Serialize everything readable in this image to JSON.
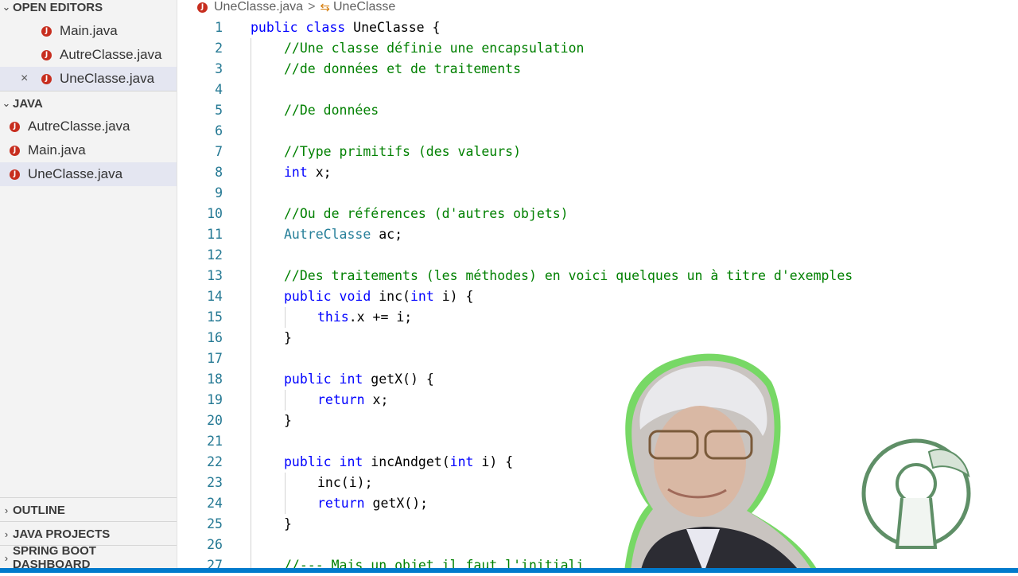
{
  "sidebar": {
    "open_editors": {
      "title": "OPEN EDITORS",
      "items": [
        {
          "label": "Main.java"
        },
        {
          "label": "AutreClasse.java"
        },
        {
          "label": "UneClasse.java",
          "close": "×"
        }
      ]
    },
    "java": {
      "title": "JAVA",
      "items": [
        {
          "label": "AutreClasse.java"
        },
        {
          "label": "Main.java"
        },
        {
          "label": "UneClasse.java"
        }
      ]
    },
    "panels": [
      {
        "label": "OUTLINE"
      },
      {
        "label": "JAVA PROJECTS"
      },
      {
        "label": "SPRING BOOT DASHBOARD"
      }
    ]
  },
  "breadcrumb": {
    "file": "UneClasse.java",
    "separator": ">",
    "symbol": "UneClasse"
  },
  "code_lines": [
    {
      "n": "1",
      "t": "public class UneClasse {"
    },
    {
      "n": "2",
      "t": "//Une classe définie une encapsulation"
    },
    {
      "n": "3",
      "t": "//de données et de traitements"
    },
    {
      "n": "4",
      "t": ""
    },
    {
      "n": "5",
      "t": "//De données"
    },
    {
      "n": "6",
      "t": ""
    },
    {
      "n": "7",
      "t": "//Type primitifs (des valeurs)"
    },
    {
      "n": "8",
      "t": "int x;"
    },
    {
      "n": "9",
      "t": ""
    },
    {
      "n": "10",
      "t": "//Ou de références (d'autres objets)"
    },
    {
      "n": "11",
      "t": "AutreClasse ac;"
    },
    {
      "n": "12",
      "t": ""
    },
    {
      "n": "13",
      "t": "//Des traitements (les méthodes) en voici quelques un à titre d'exemples"
    },
    {
      "n": "14",
      "t": "public void inc(int i) {"
    },
    {
      "n": "15",
      "t": "this.x += i;"
    },
    {
      "n": "16",
      "t": "}"
    },
    {
      "n": "17",
      "t": ""
    },
    {
      "n": "18",
      "t": "public int getX() {"
    },
    {
      "n": "19",
      "t": "return x;"
    },
    {
      "n": "20",
      "t": "}"
    },
    {
      "n": "21",
      "t": ""
    },
    {
      "n": "22",
      "t": "public int incAndget(int i) {"
    },
    {
      "n": "23",
      "t": "inc(i);"
    },
    {
      "n": "24",
      "t": "return getX();"
    },
    {
      "n": "25",
      "t": "}"
    },
    {
      "n": "26",
      "t": ""
    },
    {
      "n": "27",
      "t": "//--- Mais un objet il faut l'initiali"
    }
  ],
  "colors": {
    "keyword": "#0000ff",
    "comment": "#008000",
    "type": "#267f99",
    "line_number": "#237893",
    "java_icon": "#c72e1f",
    "status_bar": "#007acc"
  },
  "icons": {
    "java_file": "java-file-icon",
    "class_symbol": "class-symbol-icon",
    "chevron": "chevron-icon"
  }
}
